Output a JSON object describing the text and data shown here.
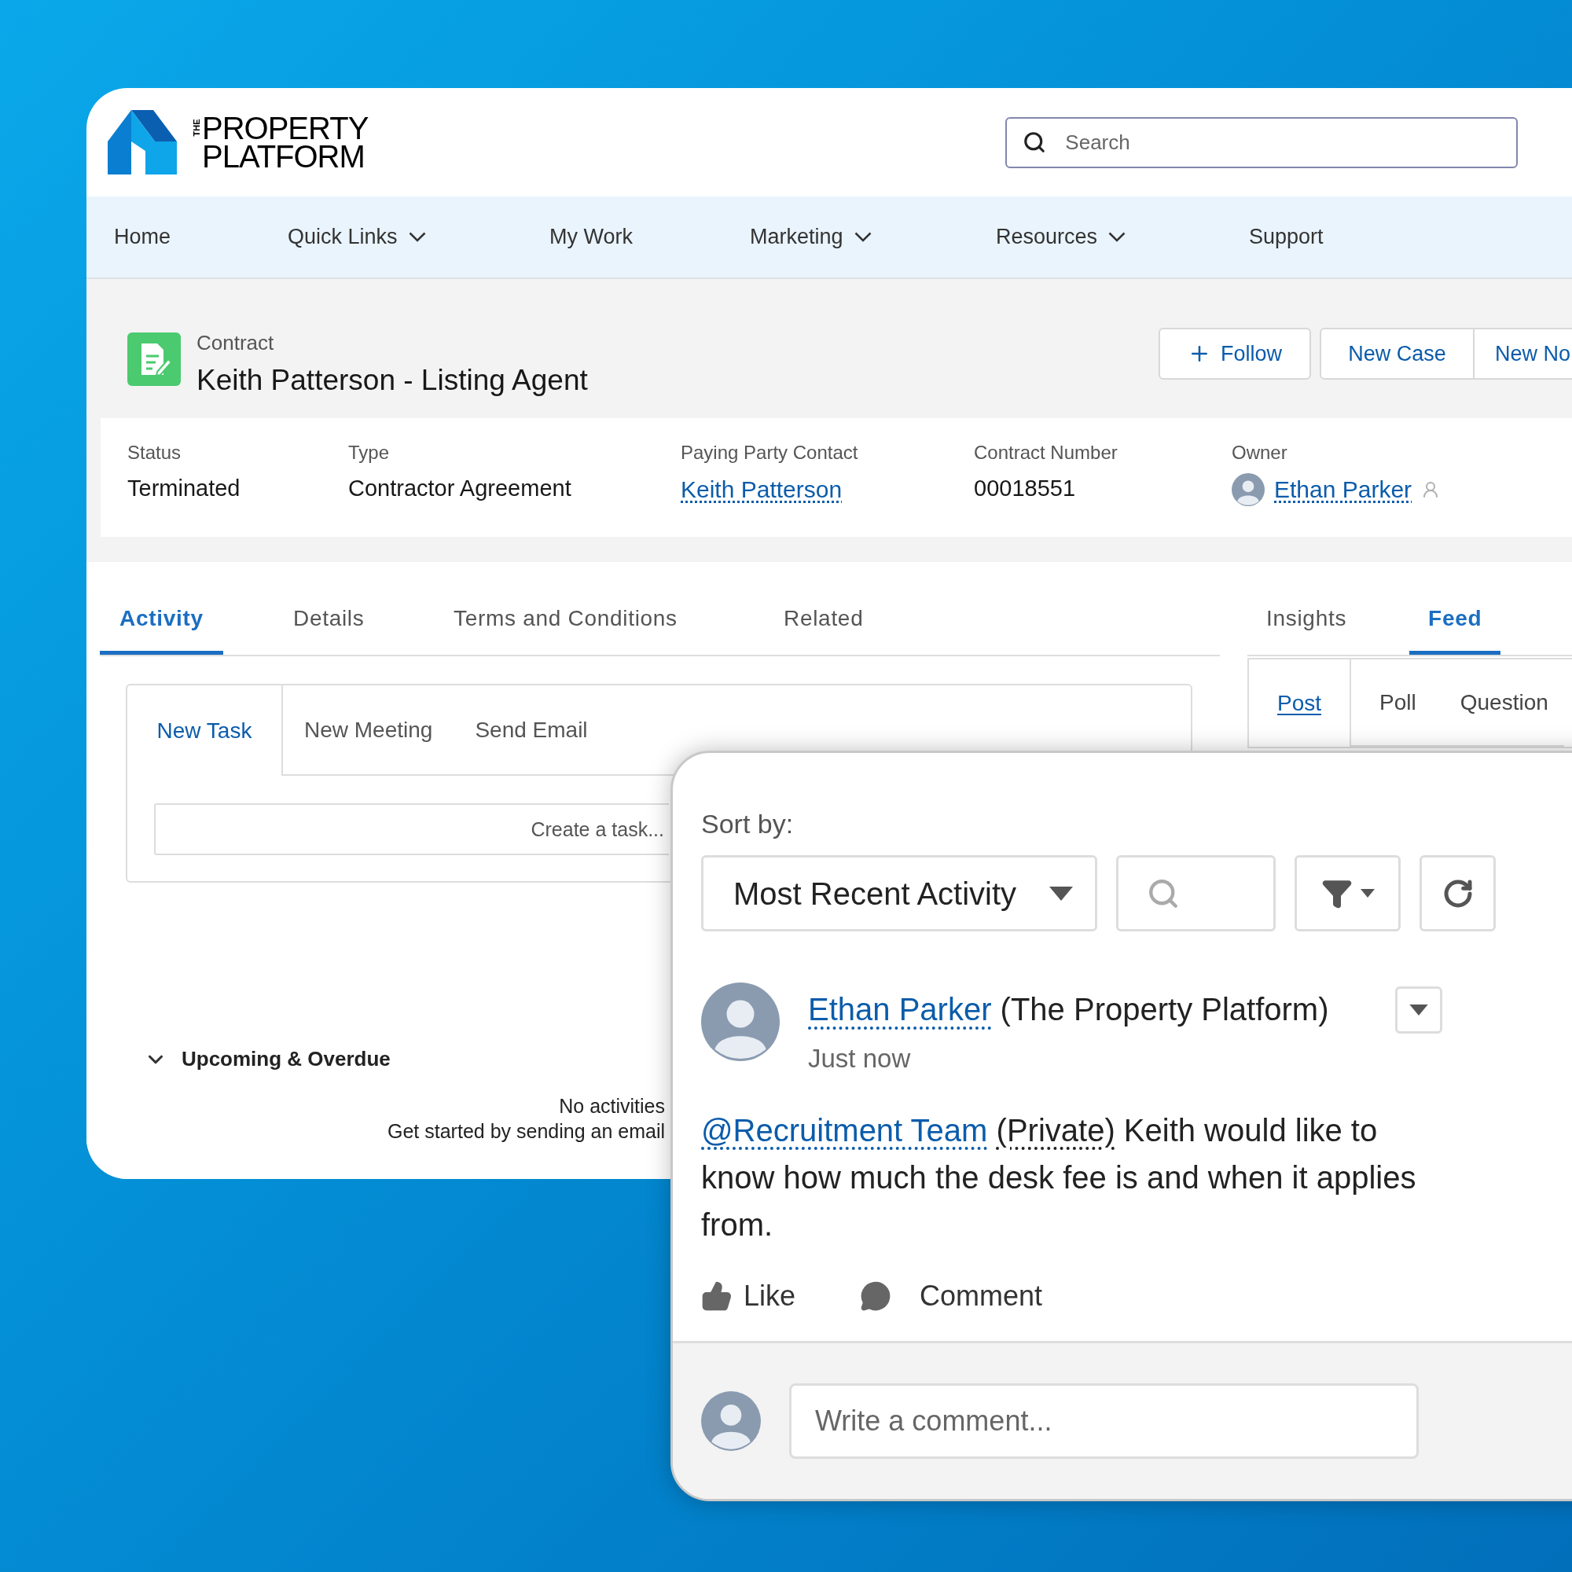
{
  "logo": {
    "small": "THE",
    "lines": [
      "PROPERTY",
      "PLATFORM"
    ]
  },
  "search": {
    "placeholder": "Search"
  },
  "nav": [
    {
      "label": "Home",
      "dropdown": false
    },
    {
      "label": "Quick Links",
      "dropdown": true
    },
    {
      "label": "My Work",
      "dropdown": false
    },
    {
      "label": "Marketing",
      "dropdown": true
    },
    {
      "label": "Resources",
      "dropdown": true
    },
    {
      "label": "Support",
      "dropdown": false
    }
  ],
  "record": {
    "object": "Contract",
    "title": "Keith Patterson - Listing Agent",
    "actions": [
      {
        "label": "Follow",
        "kind": "follow"
      },
      {
        "label": "New Case",
        "kind": "plain"
      },
      {
        "label": "New No",
        "kind": "plain"
      }
    ]
  },
  "highlights": [
    {
      "label": "Status",
      "value": "Terminated",
      "kind": "text"
    },
    {
      "label": "Type",
      "value": "Contractor Agreement",
      "kind": "text"
    },
    {
      "label": "Paying Party Contact",
      "value": "Keith Patterson",
      "kind": "link"
    },
    {
      "label": "Contract Number",
      "value": "00018551",
      "kind": "text"
    },
    {
      "label": "Owner",
      "value": "Ethan Parker",
      "kind": "user"
    }
  ],
  "main_tabs": [
    {
      "label": "Activity",
      "selected": true
    },
    {
      "label": "Details",
      "selected": false
    },
    {
      "label": "Terms and Conditions",
      "selected": false
    },
    {
      "label": "Related",
      "selected": false
    }
  ],
  "side_tabs": [
    {
      "label": "Insights",
      "selected": false
    },
    {
      "label": "Feed",
      "selected": true
    }
  ],
  "composer": {
    "tabs": [
      {
        "label": "New Task",
        "selected": true
      },
      {
        "label": "New Meeting",
        "selected": false
      },
      {
        "label": "Send Email",
        "selected": false
      }
    ],
    "placeholder": "Create a task..."
  },
  "upcoming": {
    "title": "Upcoming & Overdue",
    "expanded": true,
    "empty_lines": [
      "No activities",
      "Get started by sending an email"
    ]
  },
  "publisher_tabs": [
    {
      "label": "Post",
      "selected": true
    },
    {
      "label": "Poll",
      "selected": false
    },
    {
      "label": "Question",
      "selected": false
    }
  ],
  "feed": {
    "sort_label": "Sort by:",
    "sort_value": "Most Recent Activity",
    "post": {
      "author": "Ethan Parker",
      "org": "(The Property Platform)",
      "time": "Just now",
      "mention": "@Recruitment Team",
      "visibility": "(Private)",
      "body": "Keith would like to know how much the desk fee is and when it applies from.",
      "actions": [
        {
          "label": "Like",
          "kind": "like"
        },
        {
          "label": "Comment",
          "kind": "comment"
        }
      ]
    },
    "comment_placeholder": "Write a comment..."
  }
}
